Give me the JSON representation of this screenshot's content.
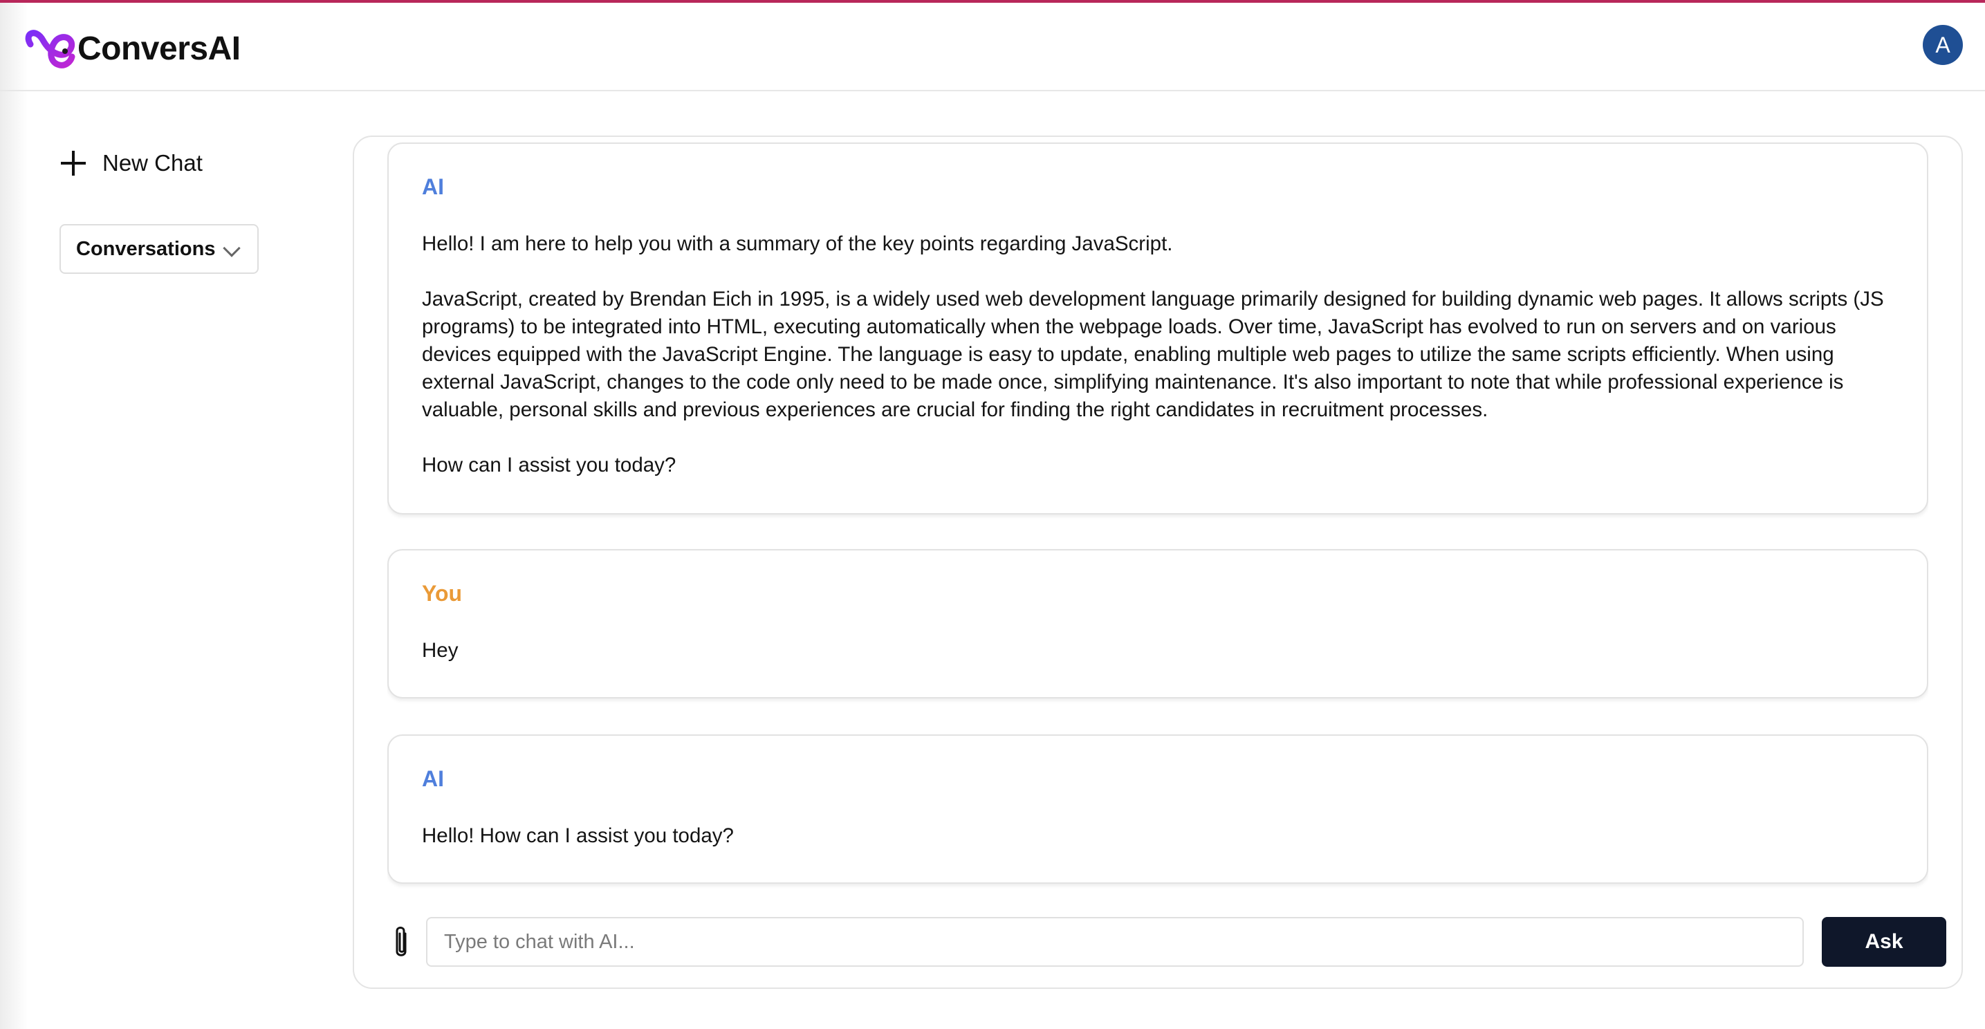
{
  "app": {
    "name": "ConversAI",
    "avatar_initial": "A",
    "colors": {
      "accent_line": "#b8275a",
      "ai_label": "#4f7fdc",
      "you_label": "#ea9a37",
      "ask_button": "#0f172a",
      "avatar": "#1f4f94"
    }
  },
  "sidebar": {
    "new_chat_label": "New Chat",
    "new_chat_icon": "plus-icon",
    "conversations_label": "Conversations",
    "conversations_icon": "chevron-down-icon"
  },
  "messages": [
    {
      "sender": "AI",
      "text": "Hello! I am here to help you with a summary of the key points regarding JavaScript.\n\nJavaScript, created by Brendan Eich in 1995, is a widely used web development language primarily designed for building dynamic web pages. It allows scripts (JS programs) to be integrated into HTML, executing automatically when the webpage loads. Over time, JavaScript has evolved to run on servers and on various devices equipped with the JavaScript Engine. The language is easy to update, enabling multiple web pages to utilize the same scripts efficiently. When using external JavaScript, changes to the code only need to be made once, simplifying maintenance. It's also important to note that while professional experience is valuable, personal skills and previous experiences are crucial for finding the right candidates in recruitment processes.\n\nHow can I assist you today?"
    },
    {
      "sender": "You",
      "text": "Hey"
    },
    {
      "sender": "AI",
      "text": "Hello! How can I assist you today?"
    }
  ],
  "composer": {
    "attach_icon": "paperclip-icon",
    "placeholder": "Type to chat with AI...",
    "value": "",
    "ask_label": "Ask"
  }
}
